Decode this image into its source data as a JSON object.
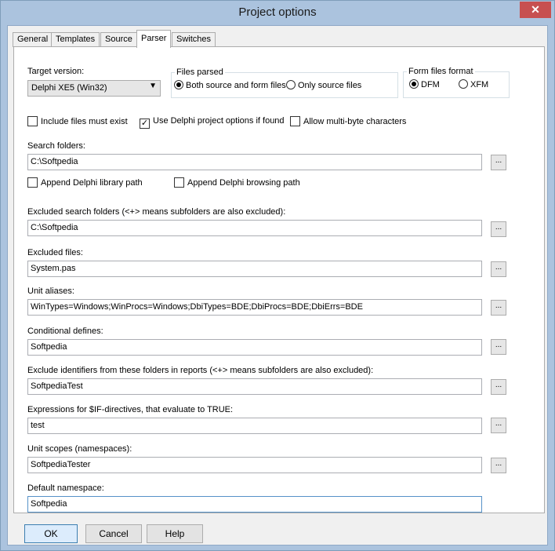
{
  "window": {
    "title": "Project options",
    "close_glyph": "✕"
  },
  "tabs": [
    {
      "label": "General"
    },
    {
      "label": "Templates"
    },
    {
      "label": "Source"
    },
    {
      "label": "Parser",
      "active": true
    },
    {
      "label": "Switches"
    }
  ],
  "target_version": {
    "label": "Target version:",
    "value": "Delphi XE5 (Win32)",
    "arrow": "▼"
  },
  "files_parsed": {
    "title": "Files parsed",
    "both": "Both source and form files",
    "only": "Only source files",
    "selected": "both"
  },
  "form_format": {
    "title": "Form files format",
    "dfm": "DFM",
    "xfm": "XFM",
    "selected": "dfm"
  },
  "checks": {
    "include_must_exist": {
      "label": "Include files must exist",
      "checked": false
    },
    "use_delphi_opts": {
      "label": "Use Delphi project options if found",
      "checked": true
    },
    "allow_multibyte": {
      "label": "Allow multi-byte characters",
      "checked": false
    },
    "append_library": {
      "label": "Append Delphi library path",
      "checked": false
    },
    "append_browsing": {
      "label": "Append Delphi browsing path",
      "checked": false
    },
    "check_glyph": "✓"
  },
  "fields": {
    "search_folders": {
      "label": "Search folders:",
      "value": "C:\\Softpedia"
    },
    "excluded_search": {
      "label": "Excluded search folders (<+> means subfolders are also excluded):",
      "value": "C:\\Softpedia"
    },
    "excluded_files": {
      "label": "Excluded files:",
      "value": "System.pas"
    },
    "unit_aliases": {
      "label": "Unit aliases:",
      "value": "WinTypes=Windows;WinProcs=Windows;DbiTypes=BDE;DbiProcs=BDE;DbiErrs=BDE"
    },
    "conditional": {
      "label": "Conditional defines:",
      "value": "Softpedia"
    },
    "exclude_identifiers": {
      "label": "Exclude identifiers from these folders in reports (<+> means subfolders are also excluded):",
      "value": "SoftpediaTest"
    },
    "expressions": {
      "label": "Expressions for $IF-directives, that evaluate to TRUE:",
      "value": "test"
    },
    "unit_scopes": {
      "label": "Unit scopes (namespaces):",
      "value": "SoftpediaTester"
    },
    "default_namespace": {
      "label": "Default namespace:",
      "value": "Softpedia"
    }
  },
  "browse_label": "...",
  "buttons": {
    "ok": "OK",
    "cancel": "Cancel",
    "help": "Help"
  }
}
